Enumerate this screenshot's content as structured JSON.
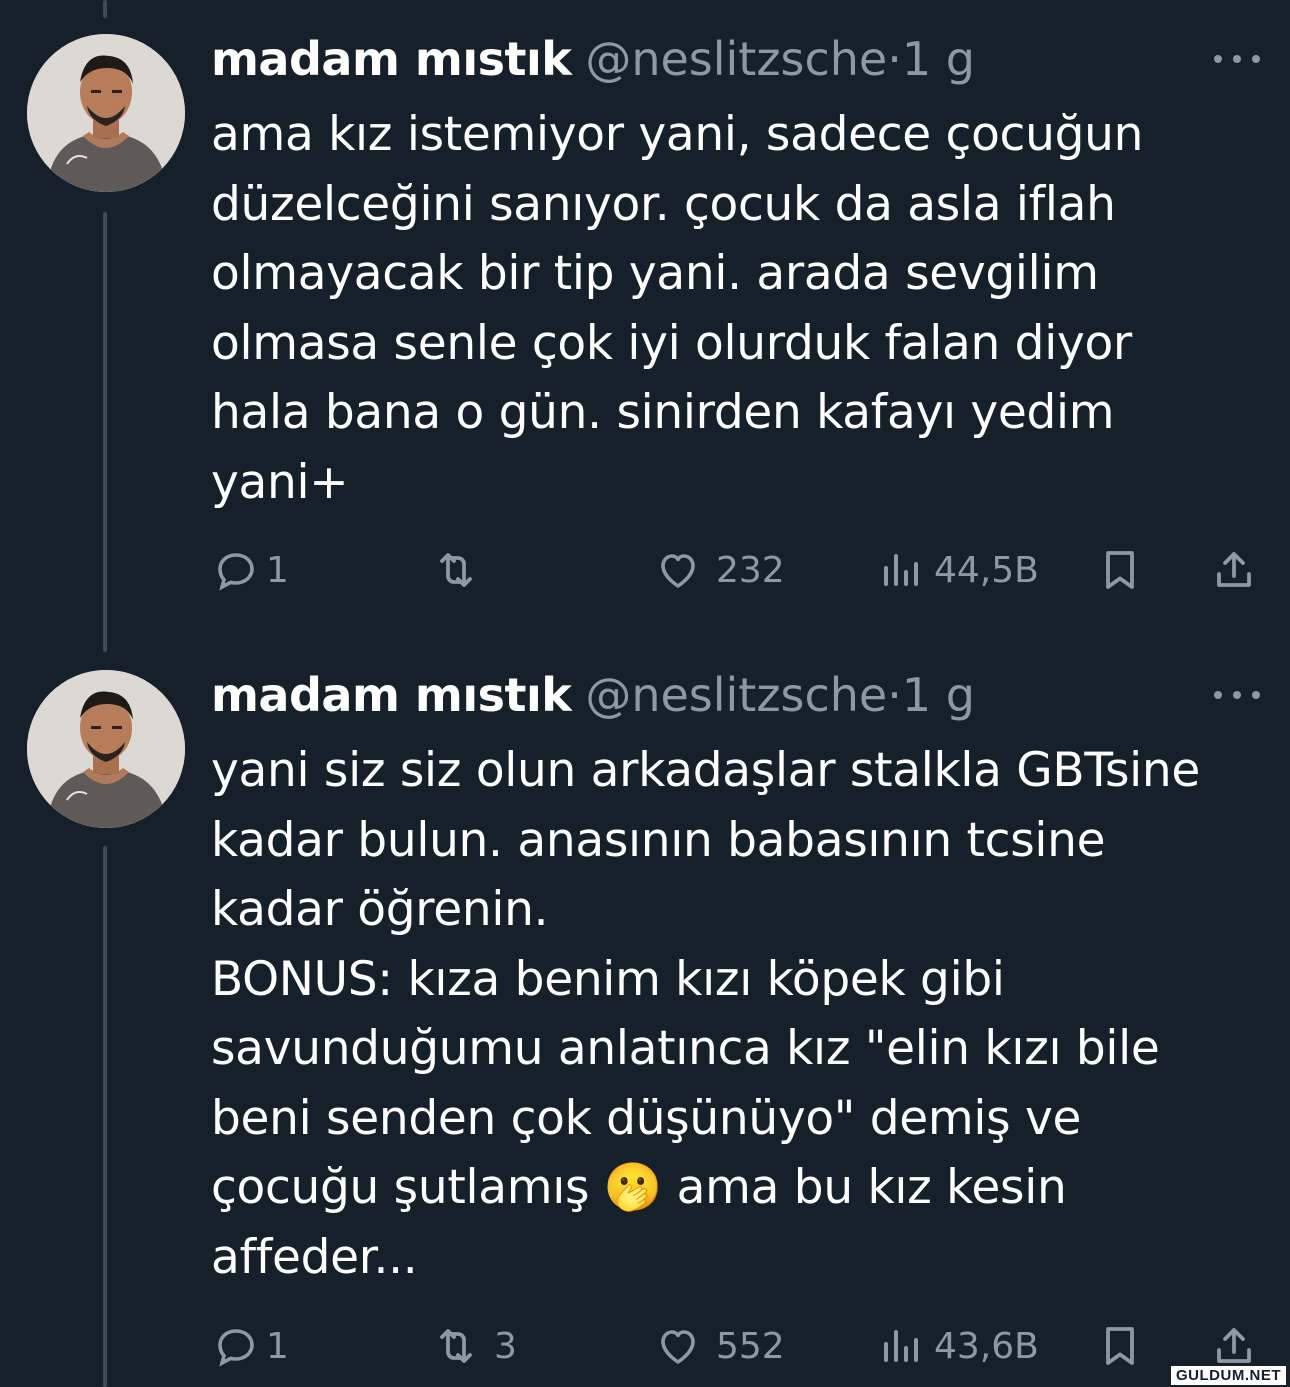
{
  "tweets": [
    {
      "name": "madam mıstık",
      "handle": "@neslitzsche",
      "separator": "·",
      "time": "1 g",
      "text": "ama kız istemiyor yani, sadece çocuğun\ndüzelceğini sanıyor. çocuk da asla iflah\nolmayacak bir tip yani. arada sevgilim\nolmasa senle çok iyi olurduk falan diyor\nhala bana o gün. sinirden kafayı yedim\nyani+",
      "replies": "1",
      "retweets": "",
      "likes": "232",
      "views": "44,5B"
    },
    {
      "name": "madam mıstık",
      "handle": "@neslitzsche",
      "separator": "·",
      "time": "1 g",
      "text": "yani siz siz olun arkadaşlar stalkla GBTsine\nkadar bulun. anasının babasının tcsine\nkadar öğrenin.\nBONUS: kıza benim kızı köpek gibi\nsavunduğumu anlatınca kız \"elin kızı bile\nbeni senden çok düşünüyo\" demiş ve\nçocuğu şutlamış 🫢 ama bu kız kesin\naffeder...",
      "replies": "1",
      "retweets": "3",
      "likes": "552",
      "views": "43,6B"
    }
  ],
  "icons": {
    "reply": "reply-icon",
    "retweet": "retweet-icon",
    "like": "heart-icon",
    "views": "views-icon",
    "bookmark": "bookmark-icon",
    "share": "share-icon",
    "more": "more-icon"
  },
  "colors": {
    "background": "#15202b",
    "secondary_text": "#8b98a5",
    "thread_line": "#3d4a57"
  },
  "watermark": "GULDUM.NET"
}
